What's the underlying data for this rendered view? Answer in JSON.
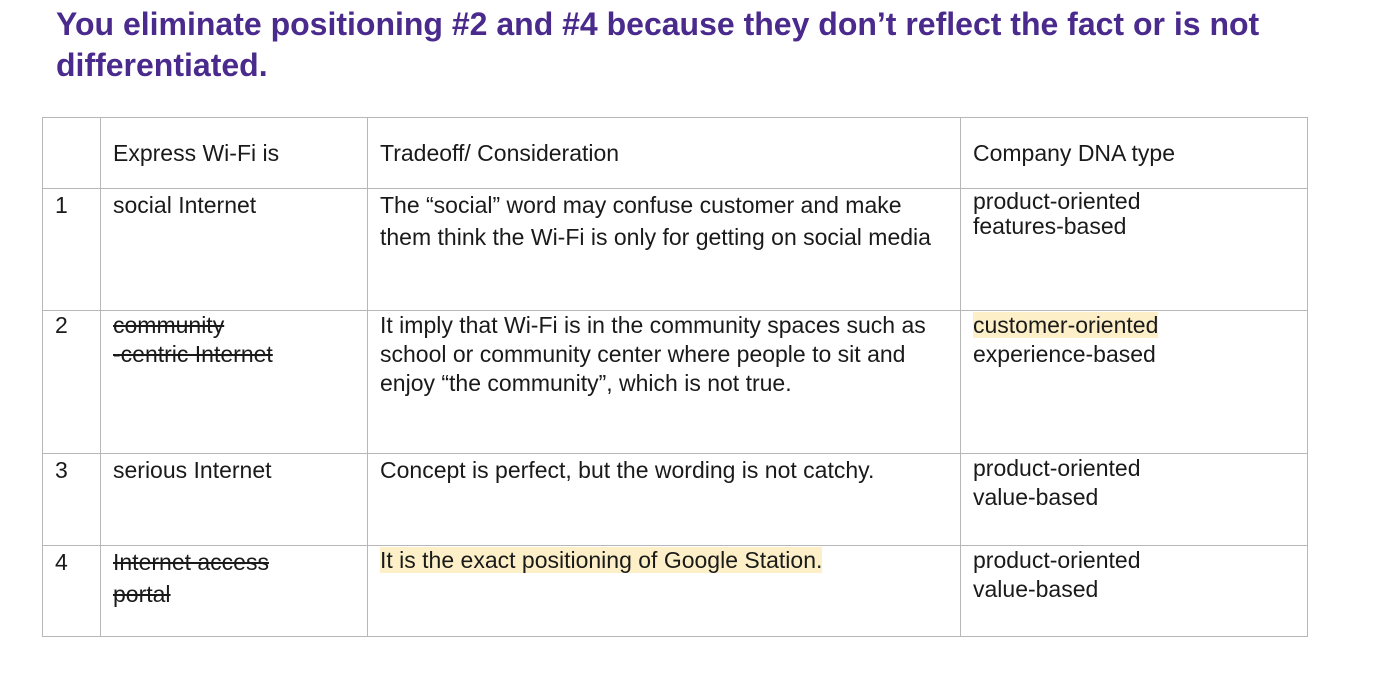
{
  "heading": "You eliminate positioning #2 and #4 because they don’t reflect the fact or is not differentiated.",
  "table": {
    "headers": {
      "number": "",
      "express": "Express Wi-Fi is",
      "tradeoff": "Tradeoff/ Consideration",
      "dna": "Company DNA type"
    },
    "rows": [
      {
        "number": "1",
        "express_line1": "social Internet",
        "express_line2": "",
        "tradeoff": "The “social” word may confuse customer and make them think the Wi-Fi is only for getting on social media",
        "dna_line1": "product-oriented",
        "dna_line2": "features-based"
      },
      {
        "number": "2",
        "express_line1": "community",
        "express_line2": "-centric Internet",
        "tradeoff": "It imply that Wi-Fi is in the community spaces such as school or community center where people to sit and enjoy “the community”, which is not true.",
        "dna_line1": "customer-oriented",
        "dna_line2": "experience-based"
      },
      {
        "number": "3",
        "express_line1": "serious Internet",
        "express_line2": "",
        "tradeoff": "Concept is perfect, but the wording is not catchy.",
        "dna_line1": "product-oriented",
        "dna_line2": "value-based"
      },
      {
        "number": "4",
        "express_line1": "Internet access",
        "express_line2": "portal",
        "tradeoff": "It is the exact positioning of Google Station.",
        "dna_line1": "product-oriented",
        "dna_line2": "value-based"
      }
    ]
  },
  "colors": {
    "heading": "#4a2a8c",
    "highlight": "#fdf0c8",
    "border": "#b7b7b7"
  }
}
